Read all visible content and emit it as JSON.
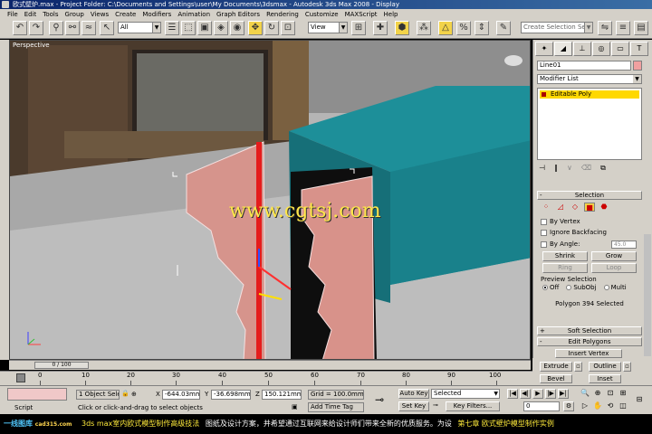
{
  "window": {
    "title": "欧式壁炉.max    - Project Folder: C:\\Documents and Settings\\user\\My Documents\\3dsmax    - Autodesk 3ds Max  2008    - Display"
  },
  "menu": [
    "File",
    "Edit",
    "Tools",
    "Group",
    "Views",
    "Create",
    "Modifiers",
    "Animation",
    "Graph Editors",
    "Rendering",
    "Customize",
    "MAXScript",
    "Help"
  ],
  "toolbar": {
    "selection_filter": "All",
    "ref_coord": "View",
    "named_selection_placeholder": "Create Selection Se"
  },
  "viewport": {
    "label": "Perspective",
    "watermark": "www.cgtsj.com"
  },
  "command_panel": {
    "object_name": "Line01",
    "modifier_list": "Modifier List",
    "stack_item": "Editable Poly",
    "selection_rollout": "Selection",
    "by_vertex": "By Vertex",
    "ignore_backfacing": "Ignore Backfacing",
    "by_angle": "By Angle:",
    "angle_value": "45.0",
    "shrink": "Shrink",
    "grow": "Grow",
    "ring": "Ring",
    "loop": "Loop",
    "preview_selection": "Preview Selection",
    "off": "Off",
    "subobj": "SubObj",
    "multi": "Multi",
    "selected_count": "Polygon 394 Selected",
    "soft_selection": "Soft Selection",
    "edit_polygons": "Edit Polygons",
    "insert_vertex": "Insert Vertex",
    "extrude": "Extrude",
    "outline": "Outline",
    "bevel": "Bevel",
    "inset": "Inset"
  },
  "timeline": {
    "frame": "0 / 100",
    "ticks": [
      "0",
      "10",
      "20",
      "30",
      "40",
      "50",
      "60",
      "70",
      "80",
      "90",
      "100"
    ]
  },
  "status": {
    "script_label": "Script",
    "selected_objects": "1 Object Sele",
    "prompt": "Click or click-and-drag to select objects",
    "x_label": "X",
    "x_value": "-644.03mm",
    "y_label": "Y",
    "y_value": "-36.698mm",
    "z_label": "Z",
    "z_value": "150.121mm",
    "grid": "Grid = 100.0mm",
    "add_time_tag": "Add Time Tag",
    "auto_key": "Auto Key",
    "selected": "Selected",
    "set_key": "Set Key",
    "key_filters": "Key Filters...",
    "current_frame": "0"
  },
  "caption": {
    "logo": "一线图库",
    "logo_sub": "cad315.com",
    "course": "3ds max室内欧式模型制作高级技法",
    "desc": "图纸及设计方案，并希望通过互联网来给设计师们带来全新的优质服务。为设",
    "chapter": "第七章 欧式壁炉模型制作实例"
  },
  "colors": {
    "teal_model": "#1d8f99",
    "panel_pink": "#e8a8a0",
    "watermark": "#ffe74a",
    "active_yellow": "#f2d34a"
  }
}
